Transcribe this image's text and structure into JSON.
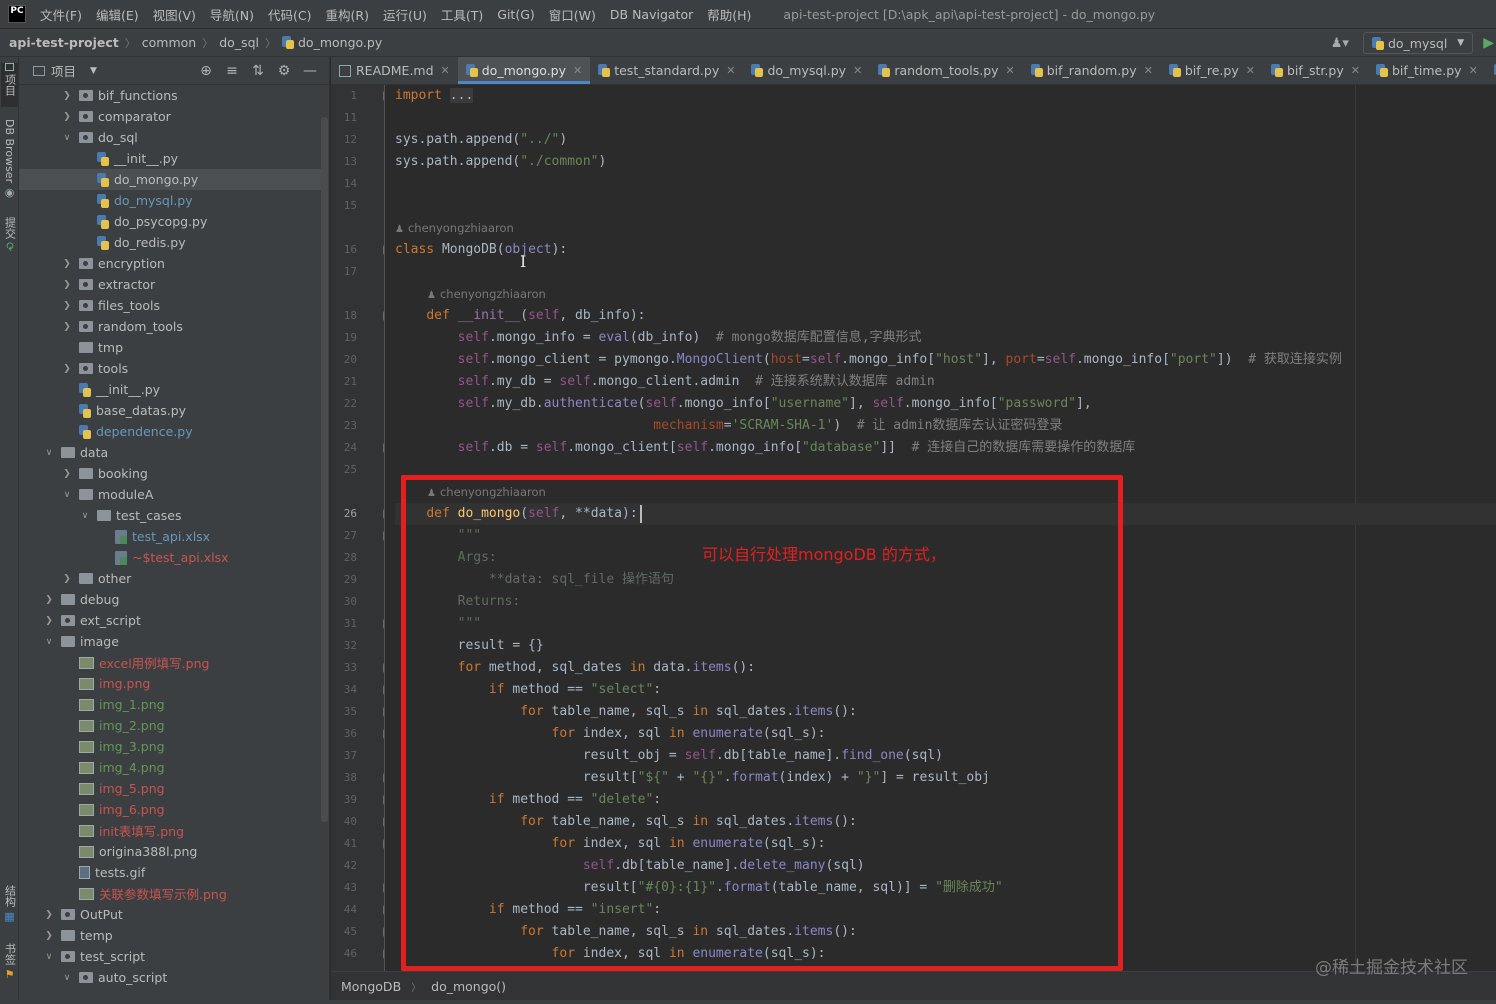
{
  "menubar": {
    "logo": "PC",
    "items": [
      "文件(F)",
      "编辑(E)",
      "视图(V)",
      "导航(N)",
      "代码(C)",
      "重构(R)",
      "运行(U)",
      "工具(T)",
      "Git(G)",
      "窗口(W)",
      "DB Navigator",
      "帮助(H)"
    ],
    "window_title": "api-test-project [D:\\apk_api\\api-test-project] - do_mongo.py"
  },
  "navbar": {
    "breadcrumb": [
      "api-test-project",
      "common",
      "do_sql",
      "do_mongo.py"
    ],
    "run_config": "do_mysql",
    "user_icon": "user-icon"
  },
  "tool_strip": {
    "top_tabs": [
      "项目",
      "DB Browser",
      "提交"
    ],
    "bottom_tabs": [
      "结构",
      "书签"
    ]
  },
  "project_panel": {
    "title": "项目",
    "tools": [
      "target-icon",
      "collapse-all-icon",
      "expand-icon",
      "gear-icon",
      "minimize-icon"
    ],
    "tree": [
      {
        "label": "bif_functions",
        "indent": 2,
        "arrow": "right",
        "icon": "folder-pkg",
        "color": "normal"
      },
      {
        "label": "comparator",
        "indent": 2,
        "arrow": "right",
        "icon": "folder-pkg",
        "color": "normal"
      },
      {
        "label": "do_sql",
        "indent": 2,
        "arrow": "down",
        "icon": "folder-pkg",
        "color": "normal"
      },
      {
        "label": "__init__.py",
        "indent": 3,
        "arrow": "",
        "icon": "py",
        "color": "normal"
      },
      {
        "label": "do_mongo.py",
        "indent": 3,
        "arrow": "",
        "icon": "py",
        "color": "normal",
        "selected": true
      },
      {
        "label": "do_mysql.py",
        "indent": 3,
        "arrow": "",
        "icon": "py",
        "color": "blue"
      },
      {
        "label": "do_psycopg.py",
        "indent": 3,
        "arrow": "",
        "icon": "py",
        "color": "normal"
      },
      {
        "label": "do_redis.py",
        "indent": 3,
        "arrow": "",
        "icon": "py",
        "color": "normal"
      },
      {
        "label": "encryption",
        "indent": 2,
        "arrow": "right",
        "icon": "folder-pkg",
        "color": "normal"
      },
      {
        "label": "extractor",
        "indent": 2,
        "arrow": "right",
        "icon": "folder-pkg",
        "color": "normal"
      },
      {
        "label": "files_tools",
        "indent": 2,
        "arrow": "right",
        "icon": "folder-pkg",
        "color": "normal"
      },
      {
        "label": "random_tools",
        "indent": 2,
        "arrow": "right",
        "icon": "folder-pkg",
        "color": "normal"
      },
      {
        "label": "tmp",
        "indent": 2,
        "arrow": "",
        "icon": "folder",
        "color": "normal"
      },
      {
        "label": "tools",
        "indent": 2,
        "arrow": "right",
        "icon": "folder-pkg",
        "color": "normal"
      },
      {
        "label": "__init__.py",
        "indent": 2,
        "arrow": "",
        "icon": "py",
        "color": "normal"
      },
      {
        "label": "base_datas.py",
        "indent": 2,
        "arrow": "",
        "icon": "py",
        "color": "normal"
      },
      {
        "label": "dependence.py",
        "indent": 2,
        "arrow": "",
        "icon": "py",
        "color": "blue"
      },
      {
        "label": "data",
        "indent": 1,
        "arrow": "down",
        "icon": "folder",
        "color": "normal"
      },
      {
        "label": "booking",
        "indent": 2,
        "arrow": "right",
        "icon": "folder",
        "color": "normal"
      },
      {
        "label": "moduleA",
        "indent": 2,
        "arrow": "down",
        "icon": "folder",
        "color": "normal"
      },
      {
        "label": "test_cases",
        "indent": 3,
        "arrow": "down",
        "icon": "folder",
        "color": "normal"
      },
      {
        "label": "test_api.xlsx",
        "indent": 4,
        "arrow": "",
        "icon": "xlsx",
        "color": "blue"
      },
      {
        "label": "~$test_api.xlsx",
        "indent": 4,
        "arrow": "",
        "icon": "xlsx",
        "color": "red"
      },
      {
        "label": "other",
        "indent": 2,
        "arrow": "right",
        "icon": "folder",
        "color": "normal"
      },
      {
        "label": "debug",
        "indent": 1,
        "arrow": "right",
        "icon": "folder",
        "color": "normal"
      },
      {
        "label": "ext_script",
        "indent": 1,
        "arrow": "right",
        "icon": "folder-pkg",
        "color": "normal"
      },
      {
        "label": "image",
        "indent": 1,
        "arrow": "down",
        "icon": "folder",
        "color": "normal"
      },
      {
        "label": "excel用例填写.png",
        "indent": 2,
        "arrow": "",
        "icon": "img",
        "color": "red"
      },
      {
        "label": "img.png",
        "indent": 2,
        "arrow": "",
        "icon": "img",
        "color": "red"
      },
      {
        "label": "img_1.png",
        "indent": 2,
        "arrow": "",
        "icon": "img",
        "color": "green"
      },
      {
        "label": "img_2.png",
        "indent": 2,
        "arrow": "",
        "icon": "img",
        "color": "green"
      },
      {
        "label": "img_3.png",
        "indent": 2,
        "arrow": "",
        "icon": "img",
        "color": "green"
      },
      {
        "label": "img_4.png",
        "indent": 2,
        "arrow": "",
        "icon": "img",
        "color": "green"
      },
      {
        "label": "img_5.png",
        "indent": 2,
        "arrow": "",
        "icon": "img",
        "color": "red"
      },
      {
        "label": "img_6.png",
        "indent": 2,
        "arrow": "",
        "icon": "img",
        "color": "red"
      },
      {
        "label": "init表填写.png",
        "indent": 2,
        "arrow": "",
        "icon": "img",
        "color": "red"
      },
      {
        "label": "origina388l.png",
        "indent": 2,
        "arrow": "",
        "icon": "img",
        "color": "normal"
      },
      {
        "label": "tests.gif",
        "indent": 2,
        "arrow": "",
        "icon": "gif",
        "color": "normal"
      },
      {
        "label": "关联参数填写示例.png",
        "indent": 2,
        "arrow": "",
        "icon": "img",
        "color": "red"
      },
      {
        "label": "OutPut",
        "indent": 1,
        "arrow": "right",
        "icon": "folder-pkg",
        "color": "normal"
      },
      {
        "label": "temp",
        "indent": 1,
        "arrow": "right",
        "icon": "folder",
        "color": "normal"
      },
      {
        "label": "test_script",
        "indent": 1,
        "arrow": "down",
        "icon": "folder-pkg",
        "color": "normal"
      },
      {
        "label": "auto_script",
        "indent": 2,
        "arrow": "down",
        "icon": "folder-pkg",
        "color": "normal"
      }
    ]
  },
  "editor": {
    "tabs": [
      {
        "label": "README.md",
        "icon": "md"
      },
      {
        "label": "do_mongo.py",
        "icon": "py",
        "active": true
      },
      {
        "label": "test_standard.py",
        "icon": "py"
      },
      {
        "label": "do_mysql.py",
        "icon": "py"
      },
      {
        "label": "random_tools.py",
        "icon": "py"
      },
      {
        "label": "bif_random.py",
        "icon": "py"
      },
      {
        "label": "bif_re.py",
        "icon": "py"
      },
      {
        "label": "bif_str.py",
        "icon": "py"
      },
      {
        "label": "bif_time.py",
        "icon": "py"
      },
      {
        "label": "bif_c",
        "icon": "py"
      }
    ],
    "author": "chenyongzhiaaron",
    "line_numbers": [
      "1",
      "11",
      "12",
      "13",
      "14",
      "15",
      "16",
      "17",
      "18",
      "19",
      "20",
      "21",
      "22",
      "23",
      "24",
      "25",
      "26",
      "27",
      "28",
      "29",
      "30",
      "31",
      "32",
      "33",
      "34",
      "35",
      "36",
      "37",
      "38",
      "39",
      "40",
      "41",
      "42",
      "43",
      "44",
      "45",
      "46"
    ],
    "current_line": "26",
    "code_lines": [
      {
        "ln": "1",
        "html": "<span class=\"k\">import</span> <span style=\"background:#3b3b3b\">...</span>"
      },
      {
        "ln": "11",
        "html": ""
      },
      {
        "ln": "12",
        "html": "sys.path.append(<span class=\"s\">\"../\"</span>)"
      },
      {
        "ln": "13",
        "html": "sys.path.append(<span class=\"s\">\"./common\"</span>)"
      },
      {
        "ln": "14",
        "html": ""
      },
      {
        "ln": "15",
        "html": ""
      },
      {
        "ln": "16",
        "html": "<span class=\"k\">class</span> MongoDB(<span class=\"bi\">object</span>):"
      },
      {
        "ln": "17",
        "html": ""
      },
      {
        "ln": "18",
        "html": "    <span class=\"k\">def</span> <span class=\"mc\">__init__</span>(<span class=\"sf\">self</span>, db_info):"
      },
      {
        "ln": "19",
        "html": "        <span class=\"sf\">self</span>.mongo_info = <span class=\"bi\">eval</span>(db_info)  <span class=\"cm\"># mongo数据库配置信息,字典形式</span>"
      },
      {
        "ln": "20",
        "html": "        <span class=\"sf\">self</span>.mongo_client = pymongo.<span class=\"bi\">MongoClient</span>(<span class=\"pm\">host</span>=<span class=\"sf\">self</span>.mongo_info[<span class=\"s\">\"host\"</span>], <span class=\"pm\">port</span>=<span class=\"sf\">self</span>.mongo_info[<span class=\"s\">\"port\"</span>])  <span class=\"cm\"># 获取连接实例</span>"
      },
      {
        "ln": "21",
        "html": "        <span class=\"sf\">self</span>.my_db = <span class=\"sf\">self</span>.mongo_client.admin  <span class=\"cm\"># 连接系统默认数据库 admin</span>"
      },
      {
        "ln": "22",
        "html": "        <span class=\"sf\">self</span>.my_db.<span class=\"bi\">authenticate</span>(<span class=\"sf\">self</span>.mongo_info[<span class=\"s\">\"username\"</span>], <span class=\"sf\">self</span>.mongo_info[<span class=\"s\">\"password\"</span>],"
      },
      {
        "ln": "23",
        "html": "                                 <span class=\"pm\">mechanism</span>=<span class=\"s\">'SCRAM-SHA-1'</span>)  <span class=\"cm\"># 让 admin数据库去认证密码登录</span>"
      },
      {
        "ln": "24",
        "html": "        <span class=\"sf\">self</span>.db = <span class=\"sf\">self</span>.mongo_client[<span class=\"sf\">self</span>.mongo_info[<span class=\"s\">\"database\"</span>]]  <span class=\"cm\"># 连接自己的数据库需要操作的数据库</span>"
      },
      {
        "ln": "25",
        "html": ""
      },
      {
        "ln": "26",
        "html": "    <span class=\"k\">def</span> <span class=\"fn\">do_mongo</span>(<span class=\"sf\">self</span>, **data):"
      },
      {
        "ln": "27",
        "html": "        <span class=\"dcg\">\"\"\"</span>"
      },
      {
        "ln": "28",
        "html": "        <span class=\"dcg\">Args:</span>"
      },
      {
        "ln": "29",
        "html": "            <span class=\"dcg\">**data: sql_file 操作语句</span>"
      },
      {
        "ln": "30",
        "html": "        <span class=\"dcg\">Returns:</span>"
      },
      {
        "ln": "31",
        "html": "        <span class=\"dcg\">\"\"\"</span>"
      },
      {
        "ln": "32",
        "html": "        result = {}"
      },
      {
        "ln": "33",
        "html": "        <span class=\"k\">for</span> method, sql_dates <span class=\"k\">in</span> data.<span class=\"bi\">items</span>():"
      },
      {
        "ln": "34",
        "html": "            <span class=\"k\">if</span> method == <span class=\"s\">\"select\"</span>:"
      },
      {
        "ln": "35",
        "html": "                <span class=\"k\">for</span> table_name, sql_s <span class=\"k\">in</span> sql_dates.<span class=\"bi\">items</span>():"
      },
      {
        "ln": "36",
        "html": "                    <span class=\"k\">for</span> index, sql <span class=\"k\">in</span> <span class=\"bi\">enumerate</span>(sql_s):"
      },
      {
        "ln": "37",
        "html": "                        result_obj = <span class=\"sf\">self</span>.db[table_name].<span class=\"bi\">find_one</span>(sql)"
      },
      {
        "ln": "38",
        "html": "                        result[<span class=\"s\">\"${\"</span> + <span class=\"s\">\"{}\"</span>.<span class=\"bi\">format</span>(index) + <span class=\"s\">\"}\"</span>] = result_obj"
      },
      {
        "ln": "39",
        "html": "            <span class=\"k\">if</span> method == <span class=\"s\">\"delete\"</span>:"
      },
      {
        "ln": "40",
        "html": "                <span class=\"k\">for</span> table_name, sql_s <span class=\"k\">in</span> sql_dates.<span class=\"bi\">items</span>():"
      },
      {
        "ln": "41",
        "html": "                    <span class=\"k\">for</span> index, sql <span class=\"k\">in</span> <span class=\"bi\">enumerate</span>(sql_s):"
      },
      {
        "ln": "42",
        "html": "                        <span class=\"sf\">self</span>.db[table_name].<span class=\"bi\">delete_many</span>(sql)"
      },
      {
        "ln": "43",
        "html": "                        result[<span class=\"s\">\"#{0}:{1}\"</span>.<span class=\"bi\">format</span>(table_name, sql)] = <span class=\"s\">\"删除成功\"</span>"
      },
      {
        "ln": "44",
        "html": "            <span class=\"k\">if</span> method == <span class=\"s\">\"insert\"</span>:"
      },
      {
        "ln": "45",
        "html": "                <span class=\"k\">for</span> table_name, sql_s <span class=\"k\">in</span> sql_dates.<span class=\"bi\">items</span>():"
      },
      {
        "ln": "46",
        "html": "                    <span class=\"k\">for</span> index, sql <span class=\"k\">in</span> <span class=\"bi\">enumerate</span>(sql_s):"
      }
    ]
  },
  "annotation": {
    "text": "可以自行处理mongoDB 的方式，",
    "color": "#e3201f"
  },
  "bottom_breadcrumb": [
    "MongoDB",
    "do_mongo()"
  ],
  "watermark": "@稀土掘金技术社区"
}
